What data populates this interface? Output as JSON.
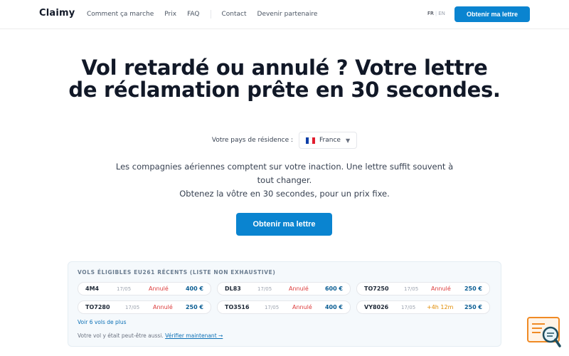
{
  "header": {
    "logo": "Claimy",
    "nav": [
      "Comment ça marche",
      "Prix",
      "FAQ",
      "Contact",
      "Devenir partenaire"
    ],
    "lang_active": "FR",
    "lang_sep": "|",
    "lang_other": "EN",
    "cta": "Obtenir ma lettre"
  },
  "hero": {
    "title": "Vol retardé ou annulé ? Votre lettre de réclamation prête en 30 secondes.",
    "country_label": "Votre pays de résidence :",
    "country_value": "France",
    "desc_line1": "Les compagnies aériennes comptent sur votre inaction. Une lettre suffit souvent à tout changer.",
    "desc_line2": "Obtenez la vôtre en 30 secondes, pour un prix fixe.",
    "cta": "Obtenir ma lettre"
  },
  "flights": {
    "title": "VOLS ÉLIGIBLES EU261 RÉCENTS (LISTE NON EXHAUSTIVE)",
    "items": [
      {
        "code": "4M4",
        "date": "17/05",
        "status": "Annulé",
        "price": "400 €"
      },
      {
        "code": "DL83",
        "date": "17/05",
        "status": "Annulé",
        "price": "600 €"
      },
      {
        "code": "TO7250",
        "date": "17/05",
        "status": "Annulé",
        "price": "250 €"
      },
      {
        "code": "TO7280",
        "date": "17/05",
        "status": "Annulé",
        "price": "250 €"
      },
      {
        "code": "TO3516",
        "date": "17/05",
        "status": "Annulé",
        "price": "400 €"
      },
      {
        "code": "VY8026",
        "date": "17/05",
        "status": "+4h 12m",
        "price": "250 €"
      }
    ],
    "more": "Voir 6 vols de plus",
    "note": "Votre vol y était peut-être aussi.",
    "note_link": "Vérifier maintenant →"
  },
  "colors": {
    "accent": "#0a84d0",
    "cancelled": "#dc3b3b",
    "delayed": "#e08a00",
    "price": "#0b5e94"
  },
  "icons": {
    "flag": "france-flag-icon",
    "caret": "chevron-down-icon",
    "widget": "search-chat-widget-icon"
  }
}
